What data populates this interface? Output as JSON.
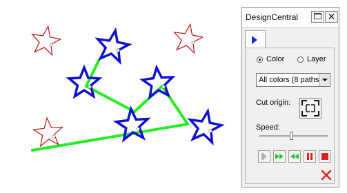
{
  "panel": {
    "title": "DesignCentral",
    "close_glyph": "✕",
    "tab_icon": "play-arrow-icon",
    "mode_options": [
      "Color",
      "Layer"
    ],
    "mode_selected": "Color",
    "paths_select": {
      "value": "All colors (8 paths)"
    },
    "cut_origin_label": "Cut origin:",
    "speed_label": "Speed:",
    "speed_level": 0.46,
    "playback_buttons": [
      "play-icon",
      "fast-forward-icon",
      "rewind-icon",
      "pause-icon",
      "stop-icon"
    ],
    "exit_icon": "red-x-icon"
  },
  "colors": {
    "unselected_star": "#c01010",
    "selected_star": "#1010d0",
    "path": "#22ee22",
    "tab_arrow": "#1a2bd8",
    "playback_green": "#22c422",
    "playback_red": "#e02020"
  }
}
